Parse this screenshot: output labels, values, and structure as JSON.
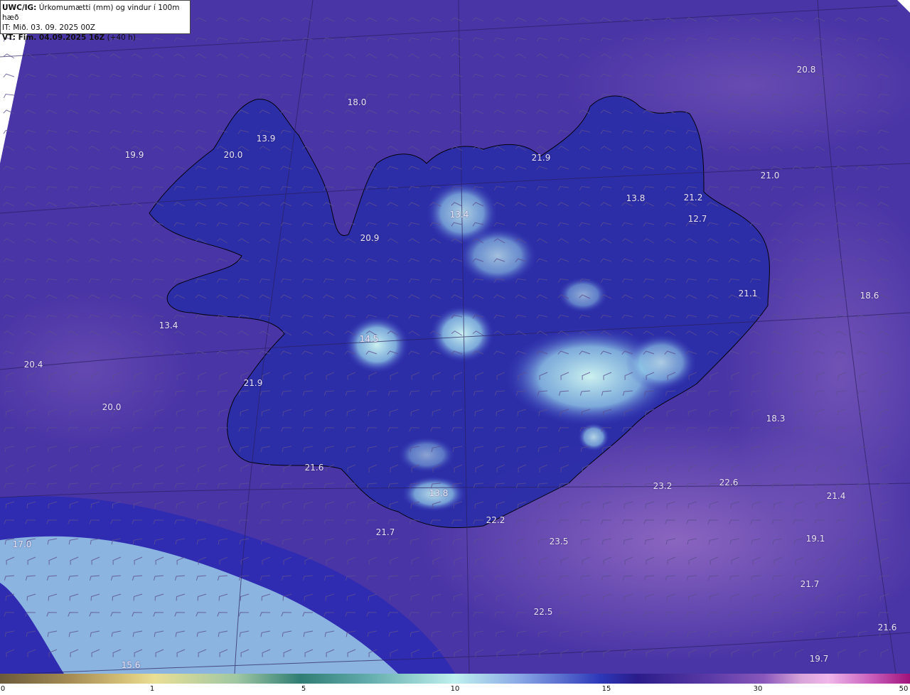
{
  "header": {
    "model": "UWC/IG:",
    "parameter": "Úrkomumætti (mm) og vindur í 100m hæð",
    "it_line": "IT: Mið. 03. 09. 2025 00Z",
    "vt_label": "VT: Fim. 04.09.2025 16Z",
    "vt_offset": "(+40 h)"
  },
  "values": [
    "20.8",
    "18.0",
    "13.9",
    "19.9",
    "20.0",
    "21.9",
    "21.0",
    "13.8",
    "21.2",
    "12.7",
    "13.4",
    "20.9",
    "21.1",
    "18.6",
    "14.5",
    "13.4",
    "20.4",
    "21.9",
    "20.0",
    "18.3",
    "21.6",
    "23.2",
    "22.6",
    "21.4",
    "13.8",
    "22.2",
    "21.7",
    "23.5",
    "17.0",
    "19.1",
    "21.7",
    "22.5",
    "21.6",
    "15.6",
    "19.7"
  ],
  "colorbar": {
    "ticks": [
      "0",
      "1",
      "5",
      "10",
      "15",
      "30",
      "50"
    ]
  },
  "colors": {
    "sea_base": "#4a35a6",
    "land_highlight": "#bff0ee",
    "coastline": "#000000"
  }
}
